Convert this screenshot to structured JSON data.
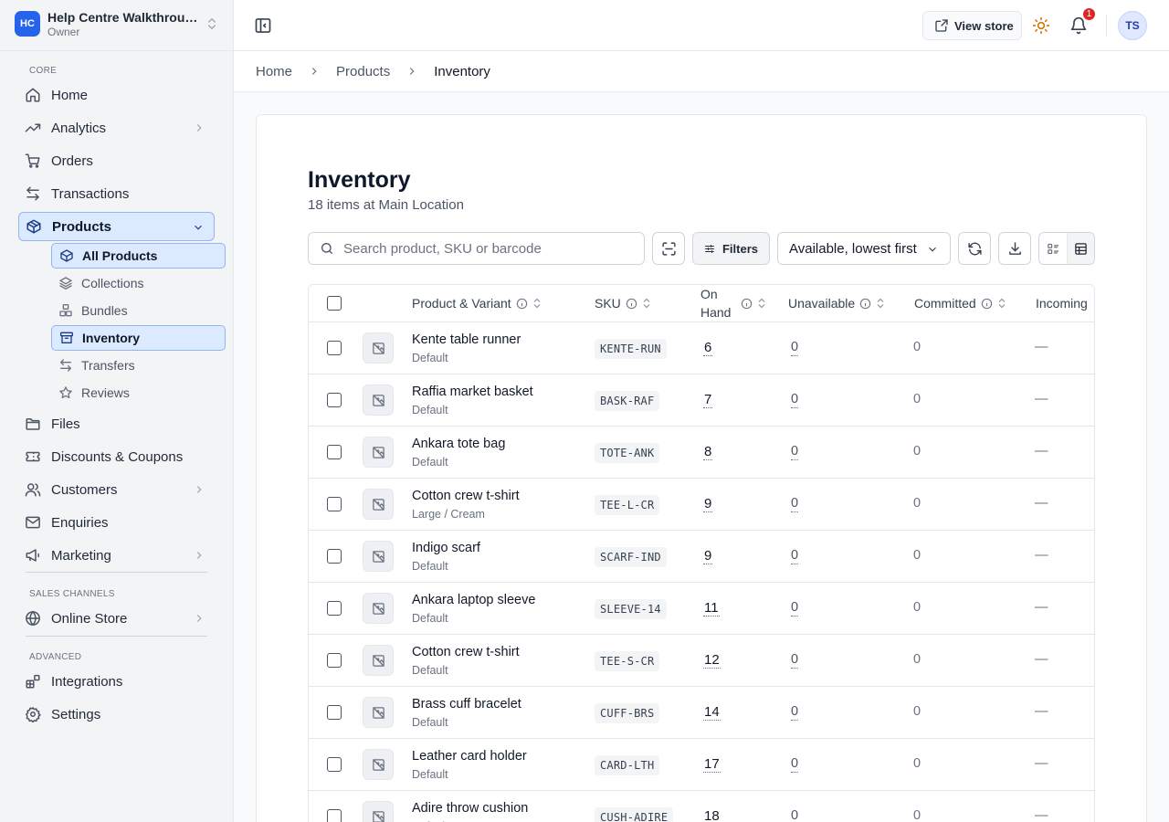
{
  "workspace": {
    "initials": "HC",
    "name": "Help Centre Walkthrough",
    "role": "Owner"
  },
  "sidebar": {
    "section_core": "CORE",
    "section_sales": "SALES CHANNELS",
    "section_advanced": "ADVANCED",
    "core_items": [
      "Home",
      "Analytics",
      "Orders",
      "Transactions",
      "Products"
    ],
    "products_sub": [
      "All Products",
      "Collections",
      "Bundles",
      "Inventory",
      "Transfers",
      "Reviews"
    ],
    "more_items": [
      "Files",
      "Discounts & Coupons",
      "Customers",
      "Enquiries",
      "Marketing"
    ],
    "sales_items": [
      "Online Store"
    ],
    "advanced_items": [
      "Integrations",
      "Settings"
    ]
  },
  "topbar": {
    "view_store": "View store",
    "notification_count": "1",
    "user_initials": "TS"
  },
  "breadcrumb": [
    "Home",
    "Products",
    "Inventory"
  ],
  "page": {
    "title": "Inventory",
    "subtitle": "18 items at Main Location",
    "search_placeholder": "Search product, SKU or barcode",
    "filters_label": "Filters",
    "sort_label": "Available, lowest first"
  },
  "table": {
    "columns": [
      "Product & Variant",
      "SKU",
      "On Hand",
      "Unavailable",
      "Committed",
      "Incoming"
    ],
    "rows": [
      {
        "name": "Kente table runner",
        "variant": "Default",
        "sku": "KENTE-RUN",
        "on_hand": "6",
        "unavailable": "0",
        "committed": "0",
        "incoming": "—"
      },
      {
        "name": "Raffia market basket",
        "variant": "Default",
        "sku": "BASK-RAF",
        "on_hand": "7",
        "unavailable": "0",
        "committed": "0",
        "incoming": "—"
      },
      {
        "name": "Ankara tote bag",
        "variant": "Default",
        "sku": "TOTE-ANK",
        "on_hand": "8",
        "unavailable": "0",
        "committed": "0",
        "incoming": "—"
      },
      {
        "name": "Cotton crew t-shirt",
        "variant": "Large / Cream",
        "sku": "TEE-L-CR",
        "on_hand": "9",
        "unavailable": "0",
        "committed": "0",
        "incoming": "—"
      },
      {
        "name": "Indigo scarf",
        "variant": "Default",
        "sku": "SCARF-IND",
        "on_hand": "9",
        "unavailable": "0",
        "committed": "0",
        "incoming": "—"
      },
      {
        "name": "Ankara laptop sleeve",
        "variant": "Default",
        "sku": "SLEEVE-14",
        "on_hand": "11",
        "unavailable": "0",
        "committed": "0",
        "incoming": "—"
      },
      {
        "name": "Cotton crew t-shirt",
        "variant": "Default",
        "sku": "TEE-S-CR",
        "on_hand": "12",
        "unavailable": "0",
        "committed": "0",
        "incoming": "—"
      },
      {
        "name": "Brass cuff bracelet",
        "variant": "Default",
        "sku": "CUFF-BRS",
        "on_hand": "14",
        "unavailable": "0",
        "committed": "0",
        "incoming": "—"
      },
      {
        "name": "Leather card holder",
        "variant": "Default",
        "sku": "CARD-LTH",
        "on_hand": "17",
        "unavailable": "0",
        "committed": "0",
        "incoming": "—"
      },
      {
        "name": "Adire throw cushion",
        "variant": "Default",
        "sku": "CUSH-ADIRE",
        "on_hand": "18",
        "unavailable": "0",
        "committed": "0",
        "incoming": "—"
      }
    ]
  }
}
